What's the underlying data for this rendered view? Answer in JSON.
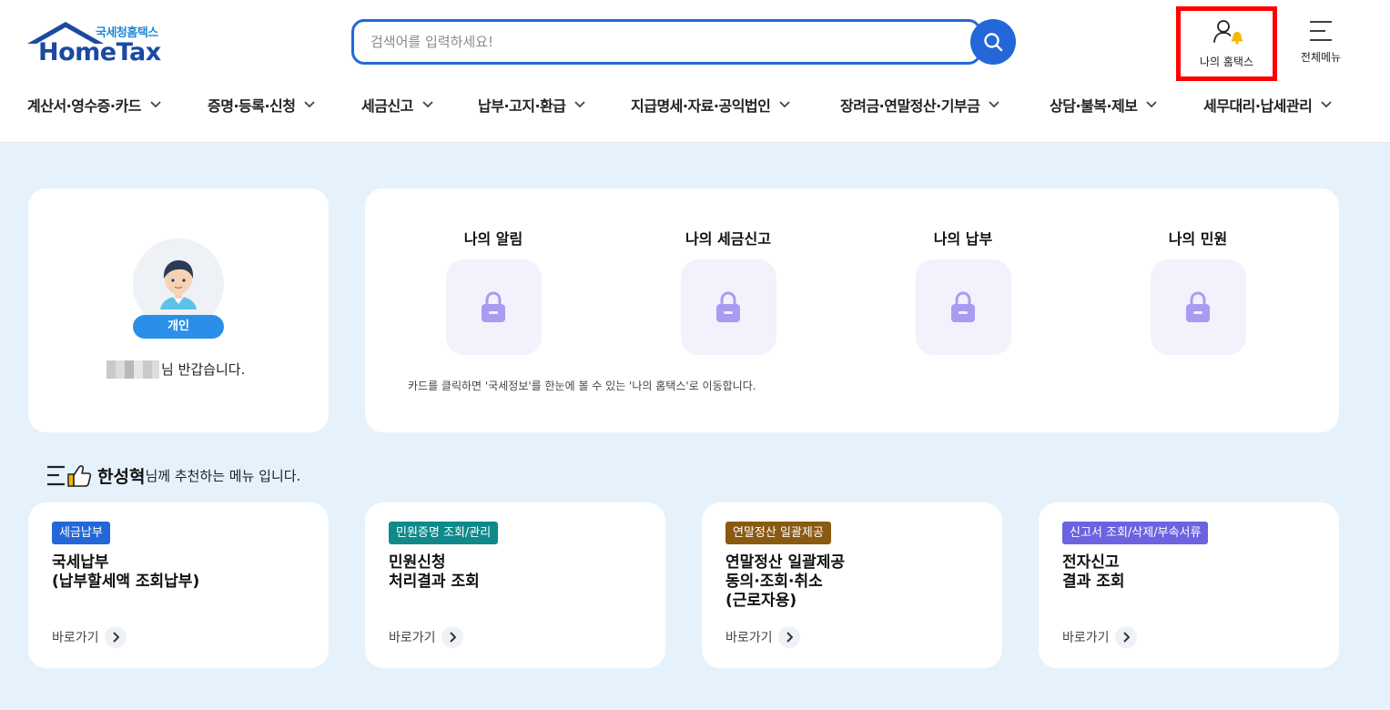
{
  "header": {
    "logo_small": "국세청홈택스",
    "logo_big": "HomeTax",
    "search": {
      "placeholder": "검색어를 입력하세요!"
    },
    "my_hometax_label": "나의 홈택스",
    "all_menu_label": "전체메뉴"
  },
  "nav": {
    "items": [
      {
        "label": "계산서·영수증·카드"
      },
      {
        "label": "증명·등록·신청"
      },
      {
        "label": "세금신고"
      },
      {
        "label": "납부·고지·환급"
      },
      {
        "label": "지급명세·자료·공익법인"
      },
      {
        "label": "장려금·연말정산·기부금"
      },
      {
        "label": "상담·불복·제보"
      },
      {
        "label": "세무대리·납세관리"
      }
    ]
  },
  "profile": {
    "badge": "개인",
    "greeting_suffix": "님 반갑습니다."
  },
  "status": {
    "items": [
      {
        "label": "나의 알림"
      },
      {
        "label": "나의 세금신고"
      },
      {
        "label": "나의 납부"
      },
      {
        "label": "나의 민원"
      }
    ],
    "note": "카드를 클릭하면 '국세정보'를 한눈에 볼 수 있는 '나의 홈택스'로 이동합니다."
  },
  "recommend": {
    "user_name": "한성혁",
    "heading_suffix": "님께 추천하는 메뉴 입니다.",
    "go_label": "바로가기",
    "cards": [
      {
        "tag": "세금납부",
        "tag_color": "#2467d8",
        "title": "국세납부\n(납부할세액 조회납부)"
      },
      {
        "tag": "민원증명 조회/관리",
        "tag_color": "#0f8a8a",
        "title": "민원신청\n처리결과 조회"
      },
      {
        "tag": "연말정산 일괄제공",
        "tag_color": "#8a5a12",
        "title": "연말정산 일괄제공\n동의·조회·취소\n(근로자용)"
      },
      {
        "tag": "신고서 조회/삭제/부속서류",
        "tag_color": "#6b63e0",
        "title": "전자신고\n결과 조회"
      }
    ]
  },
  "colors": {
    "accent": "#2467d8",
    "highlight_border": "#ff0000",
    "page_bg": "#e5f2fb",
    "lock": "#a89cf2"
  }
}
